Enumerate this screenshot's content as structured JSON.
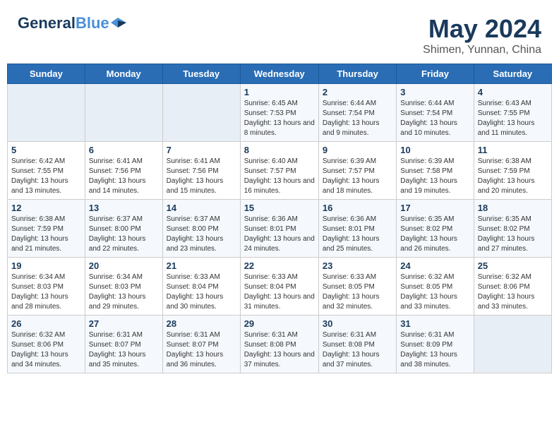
{
  "header": {
    "logo_general": "General",
    "logo_blue": "Blue",
    "title": "May 2024",
    "subtitle": "Shimen, Yunnan, China"
  },
  "weekdays": [
    "Sunday",
    "Monday",
    "Tuesday",
    "Wednesday",
    "Thursday",
    "Friday",
    "Saturday"
  ],
  "weeks": [
    [
      {
        "day": "",
        "info": ""
      },
      {
        "day": "",
        "info": ""
      },
      {
        "day": "",
        "info": ""
      },
      {
        "day": "1",
        "info": "Sunrise: 6:45 AM\nSunset: 7:53 PM\nDaylight: 13 hours and 8 minutes."
      },
      {
        "day": "2",
        "info": "Sunrise: 6:44 AM\nSunset: 7:54 PM\nDaylight: 13 hours and 9 minutes."
      },
      {
        "day": "3",
        "info": "Sunrise: 6:44 AM\nSunset: 7:54 PM\nDaylight: 13 hours and 10 minutes."
      },
      {
        "day": "4",
        "info": "Sunrise: 6:43 AM\nSunset: 7:55 PM\nDaylight: 13 hours and 11 minutes."
      }
    ],
    [
      {
        "day": "5",
        "info": "Sunrise: 6:42 AM\nSunset: 7:55 PM\nDaylight: 13 hours and 13 minutes."
      },
      {
        "day": "6",
        "info": "Sunrise: 6:41 AM\nSunset: 7:56 PM\nDaylight: 13 hours and 14 minutes."
      },
      {
        "day": "7",
        "info": "Sunrise: 6:41 AM\nSunset: 7:56 PM\nDaylight: 13 hours and 15 minutes."
      },
      {
        "day": "8",
        "info": "Sunrise: 6:40 AM\nSunset: 7:57 PM\nDaylight: 13 hours and 16 minutes."
      },
      {
        "day": "9",
        "info": "Sunrise: 6:39 AM\nSunset: 7:57 PM\nDaylight: 13 hours and 18 minutes."
      },
      {
        "day": "10",
        "info": "Sunrise: 6:39 AM\nSunset: 7:58 PM\nDaylight: 13 hours and 19 minutes."
      },
      {
        "day": "11",
        "info": "Sunrise: 6:38 AM\nSunset: 7:59 PM\nDaylight: 13 hours and 20 minutes."
      }
    ],
    [
      {
        "day": "12",
        "info": "Sunrise: 6:38 AM\nSunset: 7:59 PM\nDaylight: 13 hours and 21 minutes."
      },
      {
        "day": "13",
        "info": "Sunrise: 6:37 AM\nSunset: 8:00 PM\nDaylight: 13 hours and 22 minutes."
      },
      {
        "day": "14",
        "info": "Sunrise: 6:37 AM\nSunset: 8:00 PM\nDaylight: 13 hours and 23 minutes."
      },
      {
        "day": "15",
        "info": "Sunrise: 6:36 AM\nSunset: 8:01 PM\nDaylight: 13 hours and 24 minutes."
      },
      {
        "day": "16",
        "info": "Sunrise: 6:36 AM\nSunset: 8:01 PM\nDaylight: 13 hours and 25 minutes."
      },
      {
        "day": "17",
        "info": "Sunrise: 6:35 AM\nSunset: 8:02 PM\nDaylight: 13 hours and 26 minutes."
      },
      {
        "day": "18",
        "info": "Sunrise: 6:35 AM\nSunset: 8:02 PM\nDaylight: 13 hours and 27 minutes."
      }
    ],
    [
      {
        "day": "19",
        "info": "Sunrise: 6:34 AM\nSunset: 8:03 PM\nDaylight: 13 hours and 28 minutes."
      },
      {
        "day": "20",
        "info": "Sunrise: 6:34 AM\nSunset: 8:03 PM\nDaylight: 13 hours and 29 minutes."
      },
      {
        "day": "21",
        "info": "Sunrise: 6:33 AM\nSunset: 8:04 PM\nDaylight: 13 hours and 30 minutes."
      },
      {
        "day": "22",
        "info": "Sunrise: 6:33 AM\nSunset: 8:04 PM\nDaylight: 13 hours and 31 minutes."
      },
      {
        "day": "23",
        "info": "Sunrise: 6:33 AM\nSunset: 8:05 PM\nDaylight: 13 hours and 32 minutes."
      },
      {
        "day": "24",
        "info": "Sunrise: 6:32 AM\nSunset: 8:05 PM\nDaylight: 13 hours and 33 minutes."
      },
      {
        "day": "25",
        "info": "Sunrise: 6:32 AM\nSunset: 8:06 PM\nDaylight: 13 hours and 33 minutes."
      }
    ],
    [
      {
        "day": "26",
        "info": "Sunrise: 6:32 AM\nSunset: 8:06 PM\nDaylight: 13 hours and 34 minutes."
      },
      {
        "day": "27",
        "info": "Sunrise: 6:31 AM\nSunset: 8:07 PM\nDaylight: 13 hours and 35 minutes."
      },
      {
        "day": "28",
        "info": "Sunrise: 6:31 AM\nSunset: 8:07 PM\nDaylight: 13 hours and 36 minutes."
      },
      {
        "day": "29",
        "info": "Sunrise: 6:31 AM\nSunset: 8:08 PM\nDaylight: 13 hours and 37 minutes."
      },
      {
        "day": "30",
        "info": "Sunrise: 6:31 AM\nSunset: 8:08 PM\nDaylight: 13 hours and 37 minutes."
      },
      {
        "day": "31",
        "info": "Sunrise: 6:31 AM\nSunset: 8:09 PM\nDaylight: 13 hours and 38 minutes."
      },
      {
        "day": "",
        "info": ""
      }
    ]
  ]
}
